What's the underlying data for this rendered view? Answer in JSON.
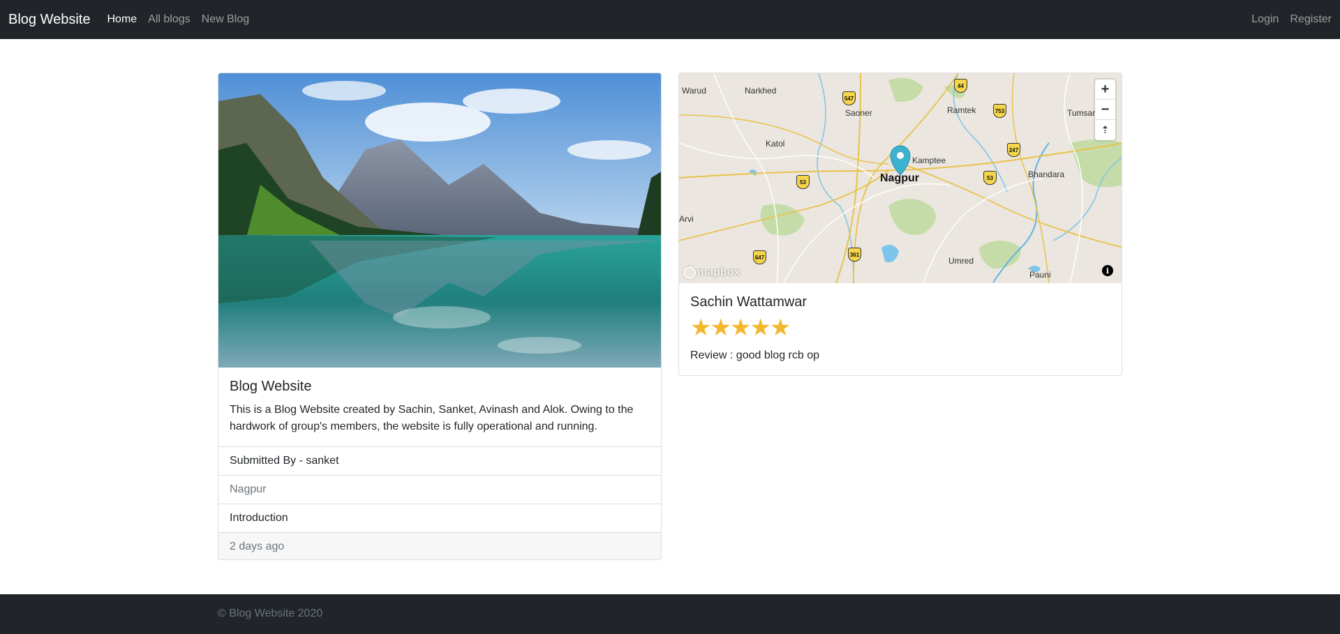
{
  "navbar": {
    "brand": "Blog Website",
    "links": [
      {
        "label": "Home",
        "active": true
      },
      {
        "label": "All blogs",
        "active": false
      },
      {
        "label": "New Blog",
        "active": false
      }
    ],
    "right_links": [
      "Login",
      "Register"
    ]
  },
  "blog": {
    "image_icon": "lake-mountain-photo",
    "title": "Blog Website",
    "description": "This is a Blog Website created by Sachin, Sanket, Avinash and Alok. Owing to the hardwork of group's members, the website is fully operational and running.",
    "submitted_by": "Submitted By - sanket",
    "location": "Nagpur",
    "category": "Introduction",
    "time_ago": "2 days ago"
  },
  "map": {
    "zoom_in": "+",
    "zoom_out": "−",
    "compass": "⇡",
    "logo_text": "mapbox",
    "info": "i",
    "labels": {
      "warud": "Warud",
      "narkhed": "Narkhed",
      "saoner": "Saoner",
      "ramtek": "Ramtek",
      "tumsar": "Tumsar",
      "katol": "Katol",
      "kamptee": "Kamptee",
      "nagpur": "Nagpur",
      "bhandara": "Bhandara",
      "arvi": "Arvi",
      "umred": "Umred",
      "pauni": "Pauni"
    },
    "shields": {
      "s547": "547",
      "s44": "44",
      "s753": "753",
      "s247": "247",
      "s53a": "53",
      "s53b": "53",
      "s647": "647",
      "s361": "361"
    },
    "marker_icon": "map-pin-icon"
  },
  "review": {
    "reviewer": "Sachin Wattamwar",
    "rating": 5,
    "stars": [
      "★",
      "★",
      "★",
      "★",
      "★"
    ],
    "text": "Review : good blog rcb op"
  },
  "footer": {
    "text": "© Blog Website 2020"
  },
  "colors": {
    "navbar_bg": "#212529",
    "star": "#f4b72b",
    "marker": "#3bb2d0"
  }
}
